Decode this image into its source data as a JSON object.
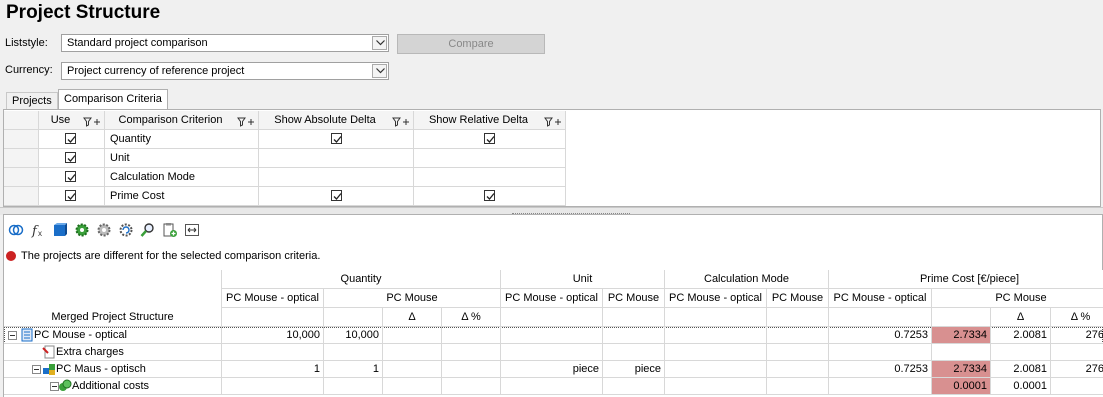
{
  "page_title": "Project Structure",
  "liststyle": {
    "label": "Liststyle:",
    "value": "Standard project comparison"
  },
  "currency": {
    "label": "Currency:",
    "value": "Project currency of reference project"
  },
  "compare_button": "Compare",
  "tabs": [
    {
      "label": "Projects",
      "active": false
    },
    {
      "label": "Comparison Criteria",
      "active": true
    }
  ],
  "criteria_grid": {
    "headers": [
      "Use",
      "Comparison Criterion",
      "Show Absolute Delta",
      "Show Relative Delta"
    ],
    "rows": [
      {
        "use": true,
        "name": "Quantity",
        "abs": true,
        "rel": true
      },
      {
        "use": true,
        "name": "Unit",
        "abs": false,
        "rel": false
      },
      {
        "use": true,
        "name": "Calculation Mode",
        "abs": false,
        "rel": false
      },
      {
        "use": true,
        "name": "Prime Cost",
        "abs": true,
        "rel": true
      }
    ]
  },
  "toolbar_icons": [
    "compare-icon",
    "formula-icon",
    "cube-icon",
    "settings-gear-icon",
    "gear-icon",
    "refresh-icon",
    "search-icon",
    "clipboard-add-icon",
    "fit-columns-icon"
  ],
  "status_message": "The projects are different for the selected comparison criteria.",
  "comparison": {
    "tree_header": "Merged Project Structure",
    "groups": [
      "Quantity",
      "Unit",
      "Calculation Mode",
      "Prime Cost [€/piece]"
    ],
    "subheaders": {
      "ref": "PC Mouse - optical",
      "cmp": "PC Mouse",
      "delta": "Δ",
      "delta_pct": "Δ %"
    },
    "rows": [
      {
        "label": "PC Mouse - optical",
        "q_ref": "10,000",
        "q_cmp": "10,000",
        "q_d": "",
        "q_dp": "",
        "u_ref": "",
        "u_cmp": "",
        "c_ref": "",
        "c_cmp": "",
        "p_ref": "0.7253",
        "p_cmp": "2.7334",
        "p_d": "2.0081",
        "p_dp": "276."
      },
      {
        "label": "Extra charges",
        "q_ref": "",
        "q_cmp": "",
        "q_d": "",
        "q_dp": "",
        "u_ref": "",
        "u_cmp": "",
        "c_ref": "",
        "c_cmp": "",
        "p_ref": "",
        "p_cmp": "",
        "p_d": "",
        "p_dp": ""
      },
      {
        "label": "PC Maus - optisch",
        "q_ref": "1",
        "q_cmp": "1",
        "q_d": "",
        "q_dp": "",
        "u_ref": "piece",
        "u_cmp": "piece",
        "c_ref": "",
        "c_cmp": "",
        "p_ref": "0.7253",
        "p_cmp": "2.7334",
        "p_d": "2.0081",
        "p_dp": "276."
      },
      {
        "label": "Additional costs",
        "q_ref": "",
        "q_cmp": "",
        "q_d": "",
        "q_dp": "",
        "u_ref": "",
        "u_cmp": "",
        "c_ref": "",
        "c_cmp": "",
        "p_ref": "",
        "p_cmp": "0.0001",
        "p_d": "0.0001",
        "p_dp": ""
      }
    ]
  },
  "colors": {
    "highlight": "#d89090",
    "error": "#cc2222",
    "accent": "#1a6ec8"
  }
}
